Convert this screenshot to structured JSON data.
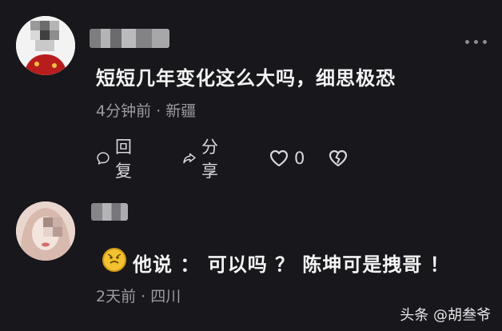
{
  "comments": [
    {
      "text": "短短几年变化这么大吗，细思极恐",
      "meta": "4分钟前 · 新疆",
      "actions": {
        "reply": "回复",
        "share": "分享",
        "like_count": "0"
      }
    },
    {
      "text": "他说 ： 可以吗 ？ 陈坤可是拽哥 ！",
      "meta": "2天前 · 四川"
    }
  ],
  "watermark": "头条 @胡叁爷",
  "icons": {
    "more": "more-dots-icon",
    "reply": "comment-bubble-icon",
    "share": "share-arrow-icon",
    "like": "heart-icon",
    "dislike": "broken-heart-icon",
    "emoji": "emoji-face-icon"
  }
}
